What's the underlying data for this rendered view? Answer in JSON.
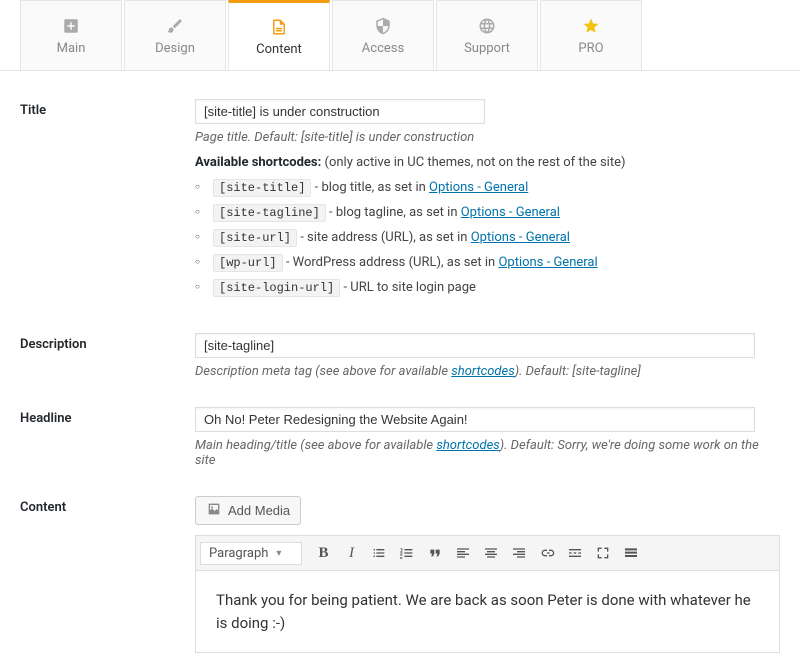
{
  "tabs": [
    {
      "id": "main",
      "label": "Main"
    },
    {
      "id": "design",
      "label": "Design"
    },
    {
      "id": "content",
      "label": "Content"
    },
    {
      "id": "access",
      "label": "Access"
    },
    {
      "id": "support",
      "label": "Support"
    },
    {
      "id": "pro",
      "label": "PRO"
    }
  ],
  "active_tab": "content",
  "title": {
    "label": "Title",
    "value": "[site-title] is under construction",
    "hint": "Page title. Default: [site-title] is under construction",
    "shortcodes_lead_bold": "Available shortcodes:",
    "shortcodes_lead_rest": " (only active in UC themes, not on the rest of the site)",
    "shortcodes": [
      {
        "code": "[site-title]",
        "text": " - blog title, as set in ",
        "link": "Options - General"
      },
      {
        "code": "[site-tagline]",
        "text": " - blog tagline, as set in ",
        "link": "Options - General"
      },
      {
        "code": "[site-url]",
        "text": " - site address (URL), as set in ",
        "link": "Options - General"
      },
      {
        "code": "[wp-url]",
        "text": " - WordPress address (URL), as set in ",
        "link": "Options - General"
      },
      {
        "code": "[site-login-url]",
        "text": " - URL to site login page",
        "link": ""
      }
    ]
  },
  "description": {
    "label": "Description",
    "value": "[site-tagline]",
    "hint_pre": "Description meta tag (see above for available ",
    "hint_link": "shortcodes",
    "hint_post": "). Default: [site-tagline]"
  },
  "headline": {
    "label": "Headline",
    "value": "Oh No! Peter Redesigning the Website Again!",
    "hint_pre": "Main heading/title (see above for available ",
    "hint_link": "shortcodes",
    "hint_post": "). Default: Sorry, we're doing some work on the site"
  },
  "content": {
    "label": "Content",
    "add_media": "Add Media",
    "format": "Paragraph",
    "body": "Thank you for being patient. We are back as soon Peter is done with whatever he is doing :-)"
  }
}
